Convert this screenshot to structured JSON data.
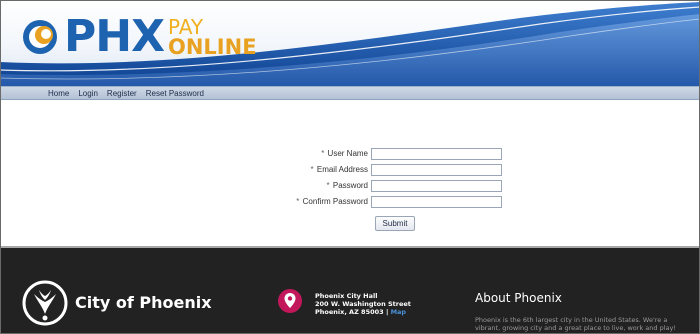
{
  "logo": {
    "main": "PHX",
    "pay": "PAY",
    "online": "ONLINE"
  },
  "nav": {
    "items": [
      {
        "label": "Home"
      },
      {
        "label": "Login"
      },
      {
        "label": "Register"
      },
      {
        "label": "Reset Password"
      }
    ]
  },
  "form": {
    "required_marker": "*",
    "fields": [
      {
        "label": "User Name",
        "value": ""
      },
      {
        "label": "Email Address",
        "value": ""
      },
      {
        "label": "Password",
        "value": ""
      },
      {
        "label": "Confirm Password",
        "value": ""
      }
    ],
    "submit_label": "Submit"
  },
  "footer": {
    "city_name": "City of Phoenix",
    "address": {
      "line1": "Phoenix City Hall",
      "line2": "200 W. Washington Street",
      "line3": "Phoenix, AZ 85003",
      "separator": "|",
      "map_label": "Map"
    },
    "about_title": "About Phoenix",
    "about_text_line1": "Phoenix is the 6th largest city in the United States. We're a",
    "about_text_line2": "vibrant, growing city and a great place to live, work and play!"
  },
  "colors": {
    "brand_blue": "#1d63b0",
    "brand_gold": "#e8a120",
    "footer_bg": "#222222",
    "pin_magenta": "#c2185b",
    "map_link": "#4a90d9"
  }
}
